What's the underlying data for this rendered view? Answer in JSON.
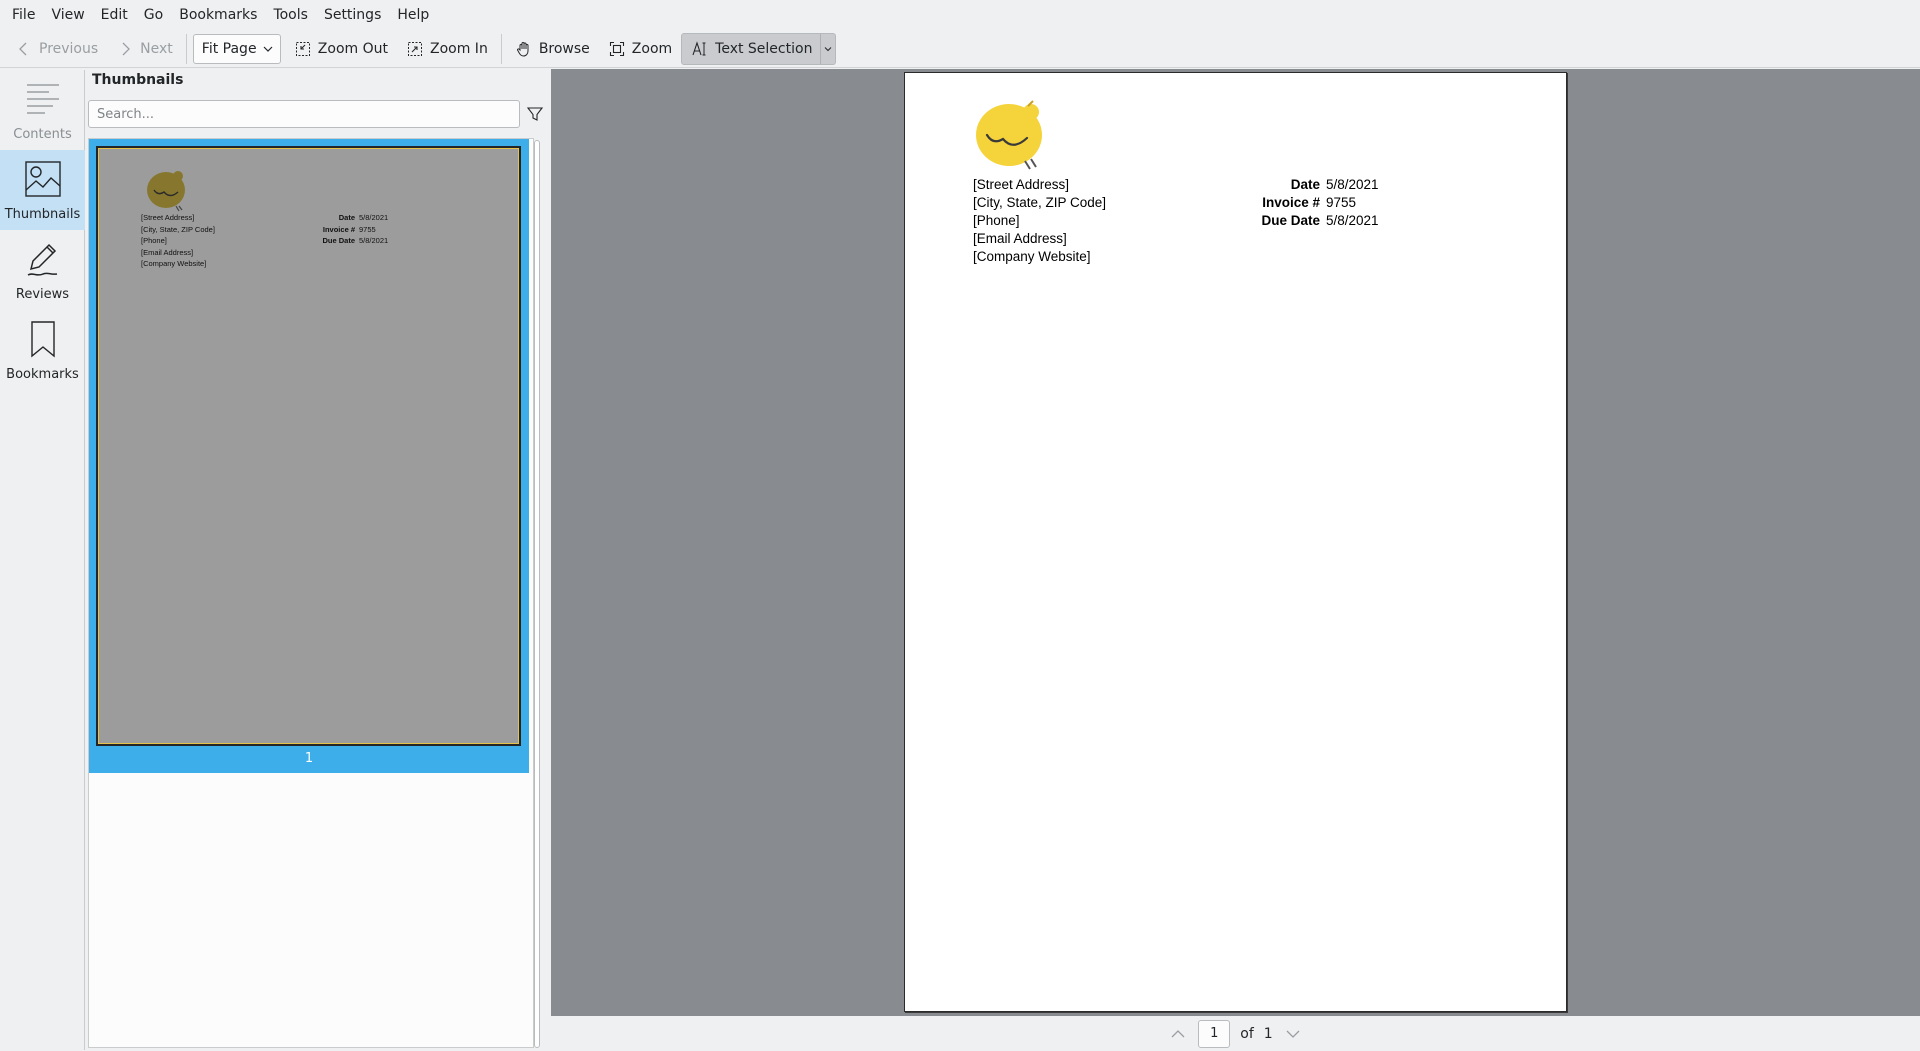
{
  "menubar": {
    "items": [
      "File",
      "View",
      "Edit",
      "Go",
      "Bookmarks",
      "Tools",
      "Settings",
      "Help"
    ]
  },
  "toolbar": {
    "previous": "Previous",
    "next": "Next",
    "zoom_mode": "Fit Page",
    "zoom_out": "Zoom Out",
    "zoom_in": "Zoom In",
    "browse": "Browse",
    "zoom": "Zoom",
    "text_selection": "Text Selection"
  },
  "sidebar": {
    "tabs": [
      {
        "label": "Contents",
        "icon": "contents-icon",
        "state": "disabled"
      },
      {
        "label": "Thumbnails",
        "icon": "image-icon",
        "state": "active"
      },
      {
        "label": "Reviews",
        "icon": "pen-icon",
        "state": "normal"
      },
      {
        "label": "Bookmarks",
        "icon": "bookmark-icon",
        "state": "normal"
      }
    ]
  },
  "thumbnails": {
    "title": "Thumbnails",
    "search_placeholder": "Search...",
    "page_number": "1"
  },
  "document": {
    "address_lines": [
      "[Street Address]",
      "[City, State, ZIP Code]",
      "[Phone]",
      "[Email Address]",
      "[Company Website]"
    ],
    "meta": [
      {
        "label": "Date",
        "value": "5/8/2021"
      },
      {
        "label": "Invoice #",
        "value": "9755"
      },
      {
        "label": "Due Date",
        "value": "5/8/2021"
      }
    ],
    "logo_color": "#f5d33a"
  },
  "pagenav": {
    "current_page": "1",
    "of_label": "of",
    "total_pages": "1"
  },
  "colors": {
    "accent": "#3daee9",
    "active_tab": "#c3e0f5",
    "doc_background": "#888b90"
  }
}
